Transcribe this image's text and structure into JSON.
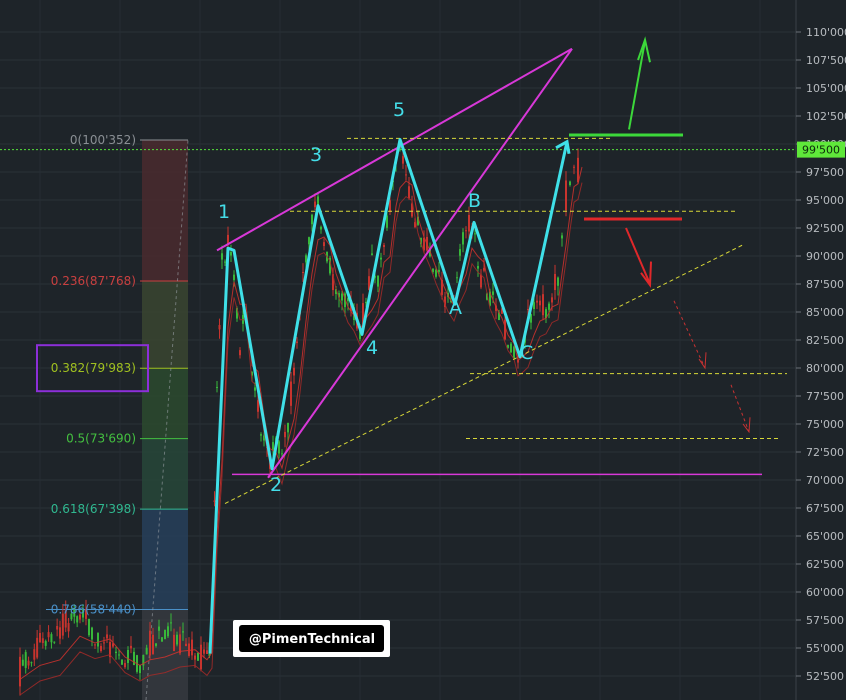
{
  "chart_data": {
    "type": "candlestick",
    "y_axis": {
      "min": 51500,
      "max": 111000,
      "ticks": [
        "52'500",
        "55'000",
        "57'500",
        "60'000",
        "62'500",
        "65'000",
        "67'500",
        "70'000",
        "72'500",
        "75'000",
        "77'500",
        "80'000",
        "82'500",
        "85'000",
        "87'500",
        "90'000",
        "92'500",
        "95'000",
        "97'500",
        "100'000",
        "102'500",
        "105'000",
        "107'500",
        "110'000"
      ],
      "tick_values": [
        52500,
        55000,
        57500,
        60000,
        62500,
        65000,
        67500,
        70000,
        72500,
        75000,
        77500,
        80000,
        82500,
        85000,
        87500,
        90000,
        92500,
        95000,
        97500,
        100000,
        102500,
        105000,
        107500,
        110000
      ],
      "current_price_label": "99'500",
      "current_price": 99500
    },
    "fibonacci": [
      {
        "label": "0(100'352)",
        "value": 100352,
        "color": "#8a8f94"
      },
      {
        "label": "0.236(87'768)",
        "value": 87768,
        "color": "#c94040"
      },
      {
        "label": "0.382(79'983)",
        "value": 79983,
        "color": "#a0c020"
      },
      {
        "label": "0.5(73'690)",
        "value": 73690,
        "color": "#44c040"
      },
      {
        "label": "0.618(67'398)",
        "value": 67398,
        "color": "#30b890"
      },
      {
        "label": "0.786(58'440)",
        "value": 58440,
        "color": "#4a90c8"
      }
    ],
    "waves": [
      {
        "label": "1",
        "price": 90700
      },
      {
        "label": "2",
        "price": 71000
      },
      {
        "label": "3",
        "price": 94500
      },
      {
        "label": "4",
        "price": 83000
      },
      {
        "label": "5",
        "price": 100400
      },
      {
        "label": "A",
        "price": 85700
      },
      {
        "label": "B",
        "price": 93000
      },
      {
        "label": "C",
        "price": 81000
      }
    ],
    "support_level": 70500,
    "resistance_level": 94000,
    "support_targets": [
      79500,
      73700
    ],
    "watermark": "@PimenTechnical"
  }
}
